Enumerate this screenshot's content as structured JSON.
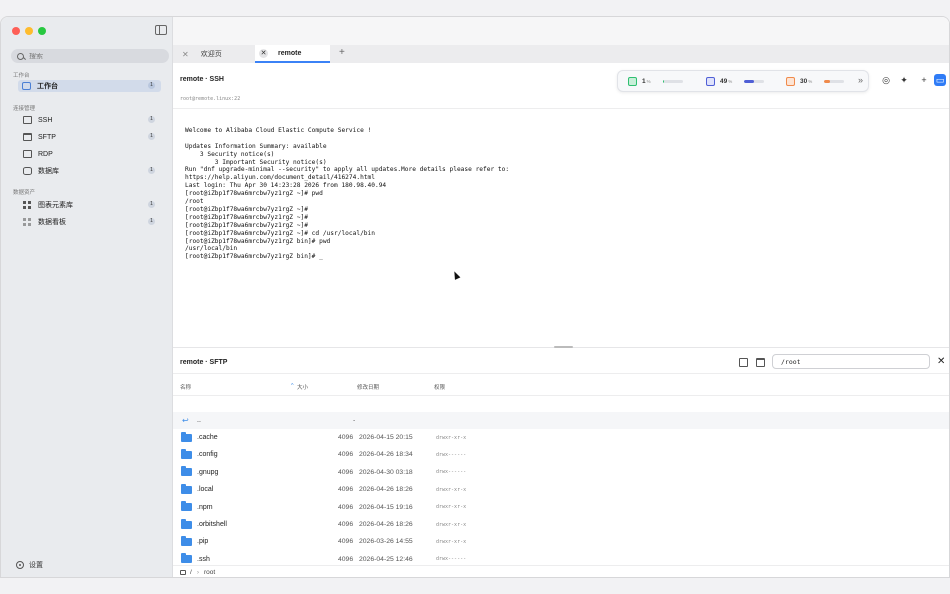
{
  "sidebar": {
    "search_placeholder": "搜索",
    "sections": {
      "workspace": "工作台",
      "connections": "连接管理",
      "assets": "数据资产"
    },
    "items": [
      {
        "label": "工作台",
        "count": "1"
      },
      {
        "label": "SSH",
        "count": "1"
      },
      {
        "label": "SFTP",
        "count": "1"
      },
      {
        "label": "RDP",
        "count": ""
      },
      {
        "label": "数据库",
        "count": "1"
      },
      {
        "label": "图表元素库",
        "count": "1"
      },
      {
        "label": "数据看板",
        "count": "1"
      }
    ],
    "settings": "设置"
  },
  "tabs": [
    {
      "label": "欢迎页"
    },
    {
      "label": "remote"
    }
  ],
  "ssh": {
    "title": "remote · SSH",
    "host": "root@remote.linux:22",
    "stats": [
      {
        "value": "1",
        "unit": "%",
        "level": 0.05,
        "color": "#2fbf71"
      },
      {
        "value": "49",
        "unit": "%",
        "level": 0.49,
        "color": "#4f5fd6"
      },
      {
        "value": "30",
        "unit": "%",
        "level": 0.3,
        "color": "#f08a4b"
      }
    ],
    "terminal_lines": [
      "",
      "Welcome to Alibaba Cloud Elastic Compute Service !",
      "",
      "Updates Information Summary: available",
      "    3 Security notice(s)",
      "        3 Important Security notice(s)",
      "Run \"dnf upgrade-minimal --security\" to apply all updates.More details please refer to:",
      "https://help.aliyun.com/document_detail/416274.html",
      "Last login: Thu Apr 30 14:23:28 2026 from 180.98.40.94",
      "[root@iZbp1f78wa6mrcbw7yz1rgZ ~]# pwd",
      "/root",
      "[root@iZbp1f78wa6mrcbw7yz1rgZ ~]#",
      "[root@iZbp1f78wa6mrcbw7yz1rgZ ~]#",
      "[root@iZbp1f78wa6mrcbw7yz1rgZ ~]#",
      "[root@iZbp1f78wa6mrcbw7yz1rgZ ~]# cd /usr/local/bin",
      "[root@iZbp1f78wa6mrcbw7yz1rgZ bin]# pwd",
      "/usr/local/bin",
      "[root@iZbp1f78wa6mrcbw7yz1rgZ bin]# _"
    ]
  },
  "sftp": {
    "title": "remote · SFTP",
    "path": "/root",
    "columns": {
      "name": "名称",
      "size": "大小",
      "modified": "修改日期",
      "perm": "权限"
    },
    "parent": {
      "name": "..",
      "size": "-"
    },
    "files": [
      {
        "name": ".cache",
        "size": "4096",
        "date": "2026-04-15 20:15",
        "perm": "drwxr-xr-x"
      },
      {
        "name": ".config",
        "size": "4096",
        "date": "2026-04-26 18:34",
        "perm": "drwx------"
      },
      {
        "name": ".gnupg",
        "size": "4096",
        "date": "2026-04-30 03:18",
        "perm": "drwx------"
      },
      {
        "name": ".local",
        "size": "4096",
        "date": "2026-04-26 18:26",
        "perm": "drwxr-xr-x"
      },
      {
        "name": ".npm",
        "size": "4096",
        "date": "2026-04-15 19:16",
        "perm": "drwxr-xr-x"
      },
      {
        "name": ".orbitshell",
        "size": "4096",
        "date": "2026-04-26 18:26",
        "perm": "drwxr-xr-x"
      },
      {
        "name": ".pip",
        "size": "4096",
        "date": "2026-03-26 14:55",
        "perm": "drwxr-xr-x"
      },
      {
        "name": ".ssh",
        "size": "4096",
        "date": "2026-04-25 12:46",
        "perm": "drwx------"
      }
    ],
    "breadcrumb": {
      "root": "/",
      "sep": "›",
      "current": "root"
    }
  }
}
